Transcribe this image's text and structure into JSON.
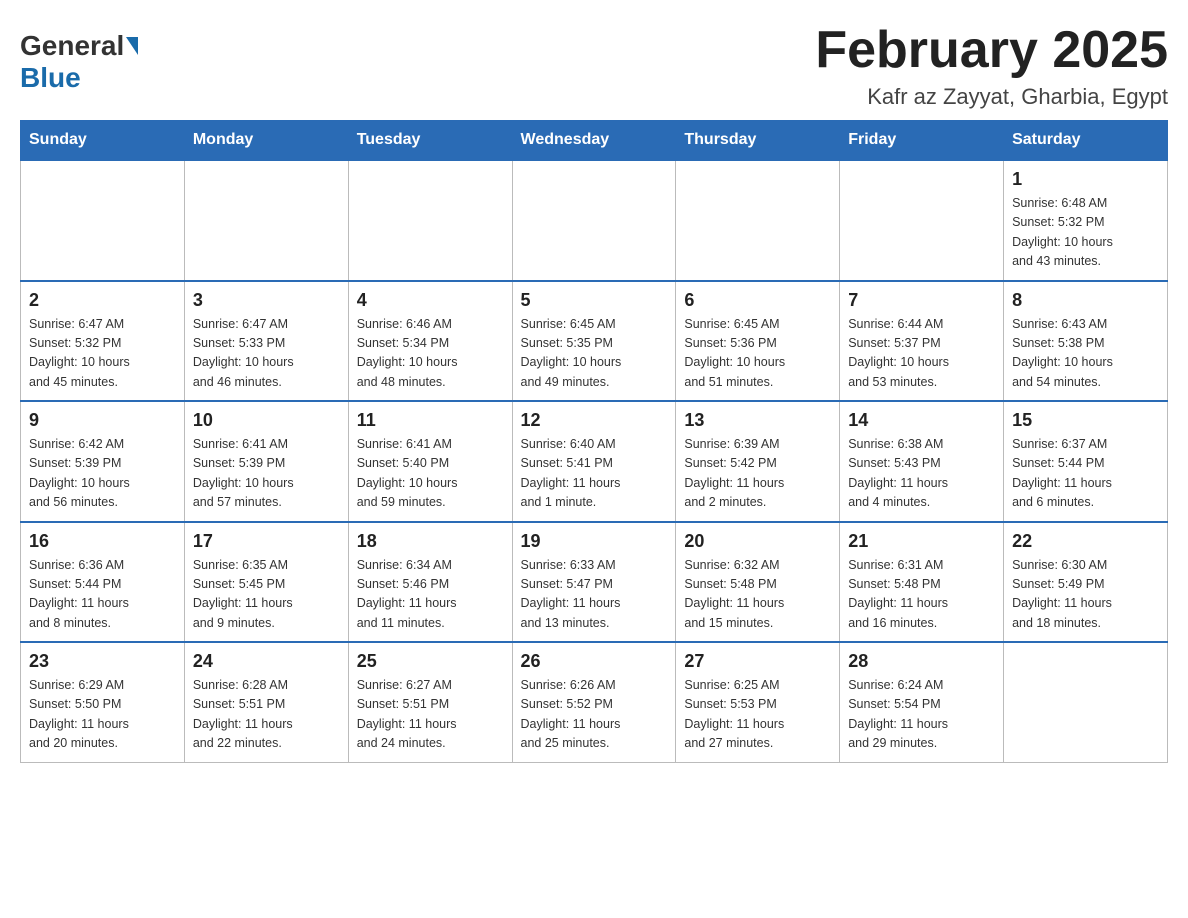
{
  "header": {
    "logo_general": "General",
    "logo_blue": "Blue",
    "month_title": "February 2025",
    "location": "Kafr az Zayyat, Gharbia, Egypt"
  },
  "weekdays": [
    "Sunday",
    "Monday",
    "Tuesday",
    "Wednesday",
    "Thursday",
    "Friday",
    "Saturday"
  ],
  "weeks": [
    [
      {
        "day": "",
        "info": ""
      },
      {
        "day": "",
        "info": ""
      },
      {
        "day": "",
        "info": ""
      },
      {
        "day": "",
        "info": ""
      },
      {
        "day": "",
        "info": ""
      },
      {
        "day": "",
        "info": ""
      },
      {
        "day": "1",
        "info": "Sunrise: 6:48 AM\nSunset: 5:32 PM\nDaylight: 10 hours\nand 43 minutes."
      }
    ],
    [
      {
        "day": "2",
        "info": "Sunrise: 6:47 AM\nSunset: 5:32 PM\nDaylight: 10 hours\nand 45 minutes."
      },
      {
        "day": "3",
        "info": "Sunrise: 6:47 AM\nSunset: 5:33 PM\nDaylight: 10 hours\nand 46 minutes."
      },
      {
        "day": "4",
        "info": "Sunrise: 6:46 AM\nSunset: 5:34 PM\nDaylight: 10 hours\nand 48 minutes."
      },
      {
        "day": "5",
        "info": "Sunrise: 6:45 AM\nSunset: 5:35 PM\nDaylight: 10 hours\nand 49 minutes."
      },
      {
        "day": "6",
        "info": "Sunrise: 6:45 AM\nSunset: 5:36 PM\nDaylight: 10 hours\nand 51 minutes."
      },
      {
        "day": "7",
        "info": "Sunrise: 6:44 AM\nSunset: 5:37 PM\nDaylight: 10 hours\nand 53 minutes."
      },
      {
        "day": "8",
        "info": "Sunrise: 6:43 AM\nSunset: 5:38 PM\nDaylight: 10 hours\nand 54 minutes."
      }
    ],
    [
      {
        "day": "9",
        "info": "Sunrise: 6:42 AM\nSunset: 5:39 PM\nDaylight: 10 hours\nand 56 minutes."
      },
      {
        "day": "10",
        "info": "Sunrise: 6:41 AM\nSunset: 5:39 PM\nDaylight: 10 hours\nand 57 minutes."
      },
      {
        "day": "11",
        "info": "Sunrise: 6:41 AM\nSunset: 5:40 PM\nDaylight: 10 hours\nand 59 minutes."
      },
      {
        "day": "12",
        "info": "Sunrise: 6:40 AM\nSunset: 5:41 PM\nDaylight: 11 hours\nand 1 minute."
      },
      {
        "day": "13",
        "info": "Sunrise: 6:39 AM\nSunset: 5:42 PM\nDaylight: 11 hours\nand 2 minutes."
      },
      {
        "day": "14",
        "info": "Sunrise: 6:38 AM\nSunset: 5:43 PM\nDaylight: 11 hours\nand 4 minutes."
      },
      {
        "day": "15",
        "info": "Sunrise: 6:37 AM\nSunset: 5:44 PM\nDaylight: 11 hours\nand 6 minutes."
      }
    ],
    [
      {
        "day": "16",
        "info": "Sunrise: 6:36 AM\nSunset: 5:44 PM\nDaylight: 11 hours\nand 8 minutes."
      },
      {
        "day": "17",
        "info": "Sunrise: 6:35 AM\nSunset: 5:45 PM\nDaylight: 11 hours\nand 9 minutes."
      },
      {
        "day": "18",
        "info": "Sunrise: 6:34 AM\nSunset: 5:46 PM\nDaylight: 11 hours\nand 11 minutes."
      },
      {
        "day": "19",
        "info": "Sunrise: 6:33 AM\nSunset: 5:47 PM\nDaylight: 11 hours\nand 13 minutes."
      },
      {
        "day": "20",
        "info": "Sunrise: 6:32 AM\nSunset: 5:48 PM\nDaylight: 11 hours\nand 15 minutes."
      },
      {
        "day": "21",
        "info": "Sunrise: 6:31 AM\nSunset: 5:48 PM\nDaylight: 11 hours\nand 16 minutes."
      },
      {
        "day": "22",
        "info": "Sunrise: 6:30 AM\nSunset: 5:49 PM\nDaylight: 11 hours\nand 18 minutes."
      }
    ],
    [
      {
        "day": "23",
        "info": "Sunrise: 6:29 AM\nSunset: 5:50 PM\nDaylight: 11 hours\nand 20 minutes."
      },
      {
        "day": "24",
        "info": "Sunrise: 6:28 AM\nSunset: 5:51 PM\nDaylight: 11 hours\nand 22 minutes."
      },
      {
        "day": "25",
        "info": "Sunrise: 6:27 AM\nSunset: 5:51 PM\nDaylight: 11 hours\nand 24 minutes."
      },
      {
        "day": "26",
        "info": "Sunrise: 6:26 AM\nSunset: 5:52 PM\nDaylight: 11 hours\nand 25 minutes."
      },
      {
        "day": "27",
        "info": "Sunrise: 6:25 AM\nSunset: 5:53 PM\nDaylight: 11 hours\nand 27 minutes."
      },
      {
        "day": "28",
        "info": "Sunrise: 6:24 AM\nSunset: 5:54 PM\nDaylight: 11 hours\nand 29 minutes."
      },
      {
        "day": "",
        "info": ""
      }
    ]
  ]
}
